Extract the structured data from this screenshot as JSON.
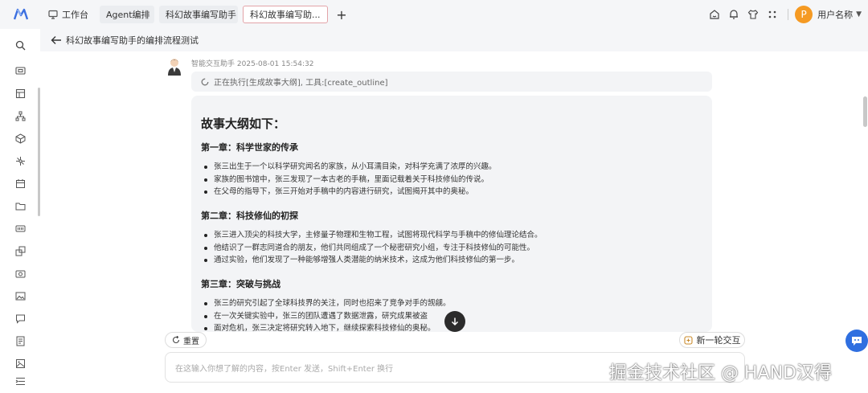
{
  "topbar": {
    "logo_icon": "brand-logo-icon",
    "tabs": [
      {
        "label": "工作台",
        "icon": "monitor-icon"
      },
      {
        "label": "Agent编排"
      },
      {
        "label": "科幻故事编写助手"
      },
      {
        "label": "科幻故事编写助..."
      }
    ],
    "user": {
      "avatar_letter": "P",
      "name": "用户名称",
      "avatar_color": "#f59a23"
    }
  },
  "header": {
    "title": "科幻故事编写助手的编排流程测试"
  },
  "message": {
    "sender": "智能交互助手",
    "timestamp": "2025-08-01 15:54:32",
    "status": "正在执行[生成故事大纲], 工具:[create_outline]"
  },
  "outline": {
    "heading": "故事大纲如下：",
    "chapters": [
      {
        "title": "第一章：科学世家的传承",
        "items": [
          "张三出生于一个以科学研究闻名的家族，从小耳濡目染，对科学充满了浓厚的兴趣。",
          "家族的图书馆中，张三发现了一本古老的手稿，里面记载着关于科技修仙的传说。",
          "在父母的指导下，张三开始对手稿中的内容进行研究，试图揭开其中的奥秘。"
        ]
      },
      {
        "title": "第二章：科技修仙的初探",
        "items": [
          "张三进入顶尖的科技大学，主修量子物理和生物工程，试图将现代科学与手稿中的修仙理论结合。",
          "他结识了一群志同道合的朋友，他们共同组成了一个秘密研究小组，专注于科技修仙的可能性。",
          "通过实验，他们发现了一种能够增强人类潜能的纳米技术，这成为他们科技修仙的第一步。"
        ]
      },
      {
        "title": "第三章：突破与挑战",
        "items": [
          "张三的研究引起了全球科技界的关注，同时也招来了竞争对手的觊觎。",
          "在一次关键实验中，张三的团队遭遇了数据泄露，研究成果被盗",
          "面对危机，张三决定将研究转入地下，继续探索科技修仙的奥秘。"
        ]
      }
    ]
  },
  "actions": {
    "reset_label": "重置",
    "new_label": "新一轮交互"
  },
  "input": {
    "placeholder": "在这输入你想了解的内容，按Enter 发送，Shift+Enter 换行"
  },
  "watermark": "掘金技术社区 @ HAND汉得",
  "colors": {
    "accent": "#2f6fe0",
    "active_tab_border": "#e3a3a8"
  }
}
